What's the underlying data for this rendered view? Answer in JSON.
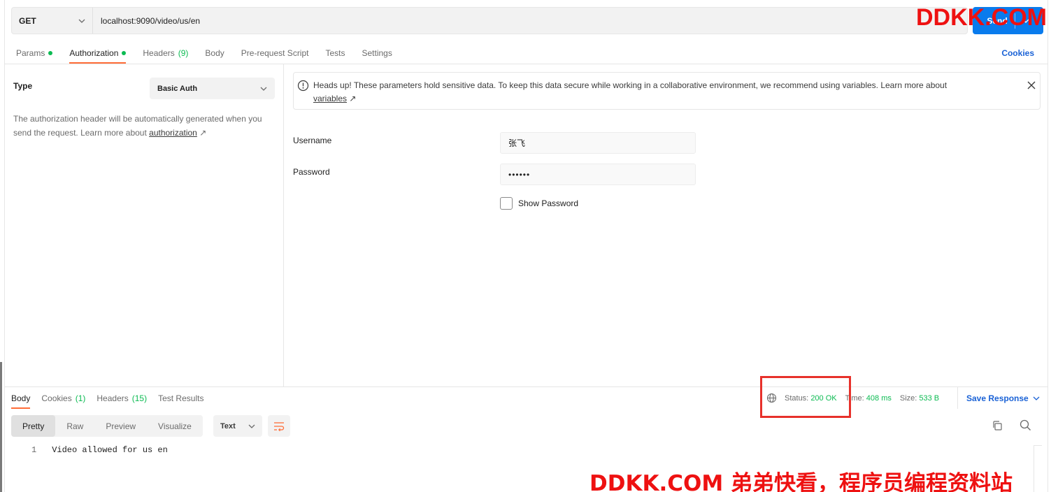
{
  "request": {
    "method": "GET",
    "url": "localhost:9090/video/us/en",
    "send_label": "Send"
  },
  "request_tabs": [
    {
      "label": "Params",
      "dot": true
    },
    {
      "label": "Authorization",
      "dot": true,
      "active": true
    },
    {
      "label": "Headers",
      "count": "(9)"
    },
    {
      "label": "Body"
    },
    {
      "label": "Pre-request Script"
    },
    {
      "label": "Tests"
    },
    {
      "label": "Settings"
    }
  ],
  "cookies_label": "Cookies",
  "auth": {
    "type_label": "Type",
    "type_value": "Basic Auth",
    "description": "The authorization header will be automatically generated when you send the request. Learn more about ",
    "description_link": "authorization",
    "link_arrow": "↗",
    "banner_text": "Heads up! These parameters hold sensitive data. To keep this data secure while working in a collaborative environment, we recommend using variables. Learn more about ",
    "banner_link": "variables",
    "username_label": "Username",
    "username_value": "张飞",
    "password_label": "Password",
    "password_value": "••••••",
    "show_password_label": "Show Password"
  },
  "response": {
    "tabs": [
      {
        "label": "Body",
        "active": true
      },
      {
        "label": "Cookies",
        "count": "(1)"
      },
      {
        "label": "Headers",
        "count": "(15)"
      },
      {
        "label": "Test Results"
      }
    ],
    "status_label": "Status:",
    "status_value": "200 OK",
    "time_label": "Time:",
    "time_value": "408 ms",
    "size_label": "Size:",
    "size_value": "533 B",
    "save_label": "Save Response",
    "views": [
      "Pretty",
      "Raw",
      "Preview",
      "Visualize"
    ],
    "active_view": "Pretty",
    "format": "Text",
    "line_number": "1",
    "body_text": "Video allowed for us en"
  },
  "watermark": {
    "top": "DDKK.COM",
    "bottom": "DDKK.COM 弟弟快看，程序员编程资料站"
  },
  "colors": {
    "accent": "#ff6c37",
    "send": "#097bed",
    "link": "#1a62d6",
    "ok": "#0cbb52",
    "highlight": "#e7312b",
    "watermark": "#ee1111"
  }
}
